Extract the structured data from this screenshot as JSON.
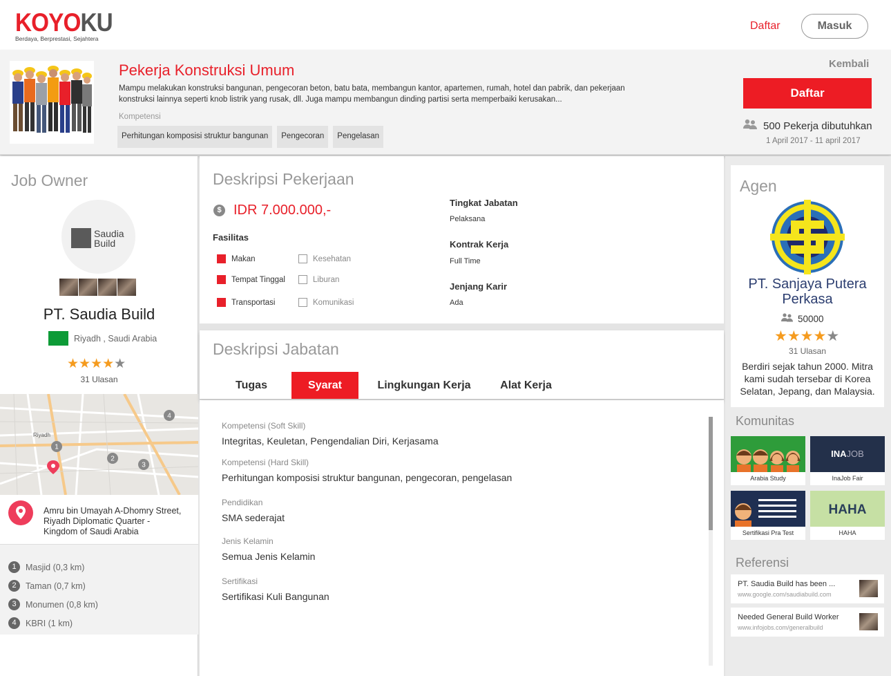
{
  "header": {
    "logo_red": "KOYO",
    "logo_grey": "KU",
    "tagline": "Berdaya, Berprestasi, Sejahtera",
    "register_link": "Daftar",
    "login_button": "Masuk"
  },
  "job": {
    "title": "Pekerja Konstruksi Umum",
    "description": "Mampu melakukan konstruksi bangunan, pengecoran beton, batu bata, membangun kantor,  apartemen, rumah, hotel dan pabrik, dan pekerjaan konstruksi lainnya seperti knob listrik yang rusak, dll. Juga mampu membangun dinding partisi serta memperbaiki kerusakan...",
    "competence_label": "Kompetensi",
    "competences": [
      "Perhitungan komposisi struktur bangunan",
      "Pengecoran",
      "Pengelasan"
    ],
    "back_label": "Kembali",
    "apply_label": "Daftar",
    "workers_needed": "500 Pekerja dibutuhkan",
    "dates": "1 April 2017 - 11 april 2017"
  },
  "owner": {
    "section_title": "Job Owner",
    "logo_text": "Saudia Build",
    "name": "PT. Saudia Build",
    "location": "Riyadh , Saudi Arabia",
    "rating": 4,
    "reviews": "31 Ulasan",
    "map_city": "Riyadh",
    "address": [
      "Amru bin Umayah A-Dhomry Street,",
      "Riyadh Diplomatic Quarter -",
      "Kingdom of Saudi Arabia"
    ],
    "nearby": [
      {
        "n": "1",
        "label": "Masjid (0,3 km)"
      },
      {
        "n": "2",
        "label": "Taman (0,7 km)"
      },
      {
        "n": "3",
        "label": "Monumen (0,8 km)"
      },
      {
        "n": "4",
        "label": "KBRI (1 km)"
      }
    ]
  },
  "job_desc": {
    "section_title": "Deskripsi Pekerjaan",
    "currency_icon": "$",
    "salary": "IDR 7.000.000,-",
    "facilities_label": "Fasilitas",
    "facilities": [
      {
        "label": "Makan",
        "checked": true
      },
      {
        "label": "Tempat Tinggal",
        "checked": true
      },
      {
        "label": "Transportasi",
        "checked": true
      },
      {
        "label": "Kesehatan",
        "checked": false
      },
      {
        "label": "Liburan",
        "checked": false
      },
      {
        "label": "Komunikasi",
        "checked": false
      }
    ],
    "level_label": "Tingkat Jabatan",
    "level_value": "Pelaksana",
    "contract_label": "Kontrak Kerja",
    "contract_value": "Full Time",
    "career_label": "Jenjang Karir",
    "career_value": "Ada"
  },
  "position": {
    "section_title": "Deskripsi Jabatan",
    "tabs": [
      "Tugas",
      "Syarat",
      "Lingkungan Kerja",
      "Alat Kerja"
    ],
    "active_tab": "Syarat",
    "requirements": [
      {
        "key": "Kompetensi (Soft Skill)",
        "value": "Integritas, Keuletan, Pengendalian Diri, Kerjasama"
      },
      {
        "key": "Kompetensi (Hard Skill)",
        "value": "Perhitungan komposisi struktur bangunan, pengecoran, pengelasan"
      },
      {
        "key": "Pendidikan",
        "value": "SMA sederajat"
      },
      {
        "key": "Jenis Kelamin",
        "value": "Semua Jenis Kelamin"
      },
      {
        "key": "Sertifikasi",
        "value": "Sertifikasi Kuli Bangunan"
      }
    ]
  },
  "agent": {
    "section_title": "Agen",
    "name": "PT. Sanjaya Putera Perkasa",
    "count": "50000",
    "rating": 4,
    "reviews": "31 Ulasan",
    "description": "Berdiri sejak tahun 2000. Mitra kami sudah tersebar di Korea Selatan, Jepang, dan Malaysia."
  },
  "community": {
    "section_title": "Komunitas",
    "items": [
      {
        "label": "Arabia Study"
      },
      {
        "label": "InaJob Fair",
        "logo_a": "INA",
        "logo_b": "JOB"
      },
      {
        "label": "Sertifikasi Pra Test"
      },
      {
        "label": "HAHA",
        "logo": "HAHA"
      }
    ]
  },
  "references": {
    "section_title": "Referensi",
    "items": [
      {
        "title": "PT. Saudia Build has been ...",
        "url": "www.google.com/saudiabuild.com"
      },
      {
        "title": "Needed General Build Worker",
        "url": "www.infojobs.com/generalbuild"
      }
    ]
  },
  "colors": {
    "accent": "#ed1c24",
    "star": "#f59b1e",
    "agent_name": "#2c3e70"
  }
}
